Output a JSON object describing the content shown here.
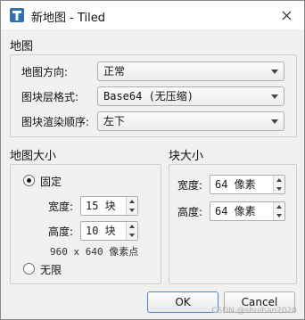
{
  "window": {
    "title": "新地图 - Tiled",
    "close_icon": "close-icon",
    "app_icon": "tiled-app-icon"
  },
  "map_section": {
    "label": "地图",
    "orientation_label": "地图方向:",
    "orientation_value": "正常",
    "layer_format_label": "图块层格式:",
    "layer_format_value": "Base64 (无压缩)",
    "render_order_label": "图块渲染顺序:",
    "render_order_value": "左下"
  },
  "map_size": {
    "label": "地图大小",
    "fixed_label": "固定",
    "width_label": "宽度:",
    "width_value": "15 块",
    "height_label": "高度:",
    "height_value": "10 块",
    "pixel_size": "960 x 640 像素点",
    "infinite_label": "无限",
    "selected": "fixed"
  },
  "tile_size": {
    "label": "块大小",
    "width_label": "宽度:",
    "width_value": "64 像素",
    "height_label": "高度:",
    "height_value": "64 像素"
  },
  "buttons": {
    "ok": "OK",
    "cancel": "Cancel"
  },
  "watermark": "CSDN @shuibao2020"
}
